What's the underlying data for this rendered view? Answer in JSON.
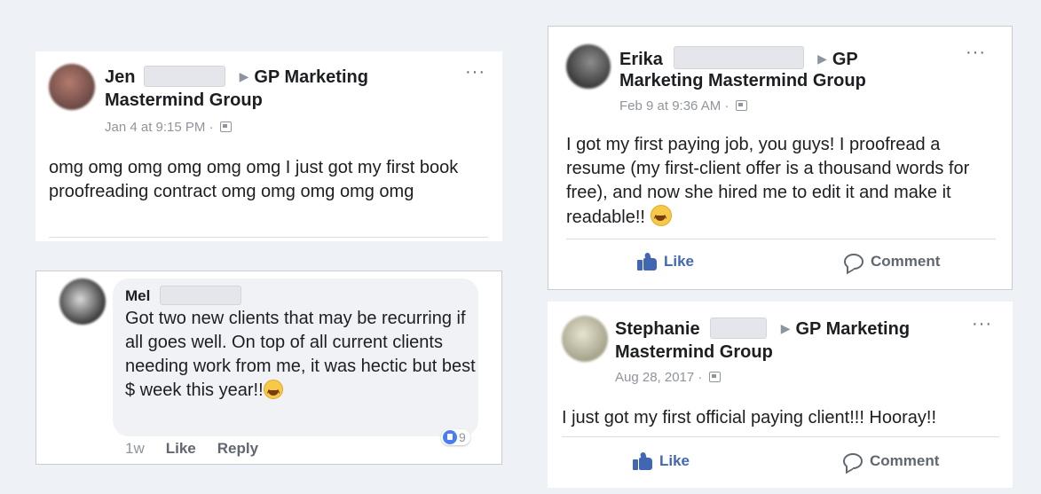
{
  "colors": {
    "background": "#eef1f6",
    "like_blue": "#4267b2",
    "text": "#1c1e21",
    "meta_gray": "#90949c"
  },
  "posts": [
    {
      "author": "Jen",
      "group": "GP Marketing",
      "group_line2": "Mastermind Group",
      "time": "Jan 4 at 9:15 PM",
      "text": "omg omg omg omg omg omg I just got my first book proofreading contract omg omg omg omg omg"
    },
    {
      "author": "Erika",
      "group": "GP",
      "group_line2": "Marketing Mastermind Group",
      "time": "Feb 9 at 9:36 AM",
      "text": "I got my first paying job, you guys! I proofread a resume (my first-client offer is a thousand words for free), and now she hired me to edit it and make it readable!!",
      "like_label": "Like",
      "comment_label": "Comment"
    },
    {
      "author": "Stephanie",
      "group": "GP Marketing",
      "group_line2": "Mastermind Group",
      "time": "Aug 28, 2017",
      "text": "I just got my first official paying client!!! Hooray!!",
      "like_label": "Like",
      "comment_label": "Comment"
    }
  ],
  "comment": {
    "author": "Mel",
    "text": "Got two new clients that may be recurring if all goes well. On top of all current clients needing work from me, it was hectic but best $ week this year!!",
    "age": "1w",
    "like_label": "Like",
    "reply_label": "Reply",
    "reaction_count": "9"
  },
  "icons": [
    "more-options-icon",
    "audience-icon",
    "like-thumb-icon",
    "comment-icon",
    "grinning-emoji-icon",
    "like-reaction-icon"
  ]
}
